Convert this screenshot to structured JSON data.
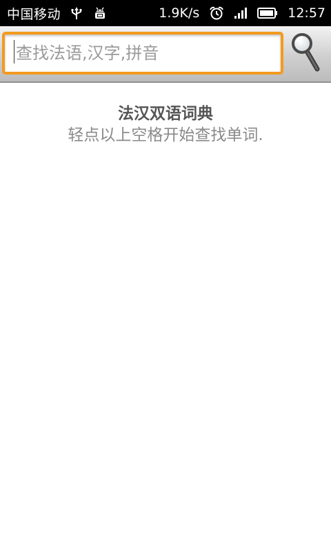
{
  "status_bar": {
    "carrier": "中国移动",
    "network_speed": "1.9K/s",
    "time": "12:57",
    "icons": [
      "usb-icon",
      "android-debug-icon",
      "alarm-icon",
      "signal-icon",
      "battery-icon"
    ]
  },
  "search": {
    "placeholder": "查找法语,汉字,拼音",
    "value": "",
    "button_icon": "search-icon",
    "focus_color": "#f39a1e"
  },
  "content": {
    "title": "法汉双语词典",
    "hint": "轻点以上空格开始查找单词."
  }
}
